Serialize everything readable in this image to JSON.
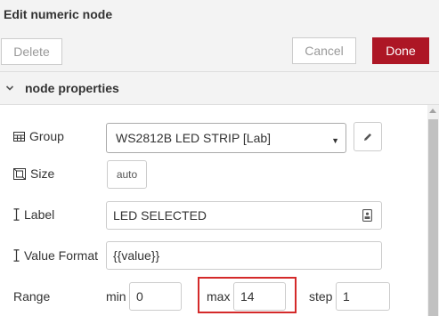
{
  "dialog": {
    "title": "Edit numeric node"
  },
  "toolbar": {
    "delete_label": "Delete",
    "cancel_label": "Cancel",
    "done_label": "Done"
  },
  "section": {
    "title": "node properties"
  },
  "fields": {
    "group": {
      "label": "Group",
      "value": "WS2812B LED STRIP [Lab]"
    },
    "size": {
      "label": "Size",
      "value": "auto"
    },
    "name_label": {
      "label": "Label",
      "value": "LED SELECTED"
    },
    "value_format": {
      "label": "Value Format",
      "value": "{{value}}"
    },
    "range": {
      "label": "Range",
      "min_label": "min",
      "min_value": "0",
      "max_label": "max",
      "max_value": "14",
      "step_label": "step",
      "step_value": "1"
    }
  },
  "colors": {
    "done_button": "#ad1625",
    "highlight_border": "#d42a2a"
  },
  "icons": [
    "chevron-down-icon",
    "table-icon",
    "size-icon",
    "i-cursor-icon",
    "pencil-icon",
    "label-badge-icon",
    "scroll-up-arrow-icon"
  ]
}
